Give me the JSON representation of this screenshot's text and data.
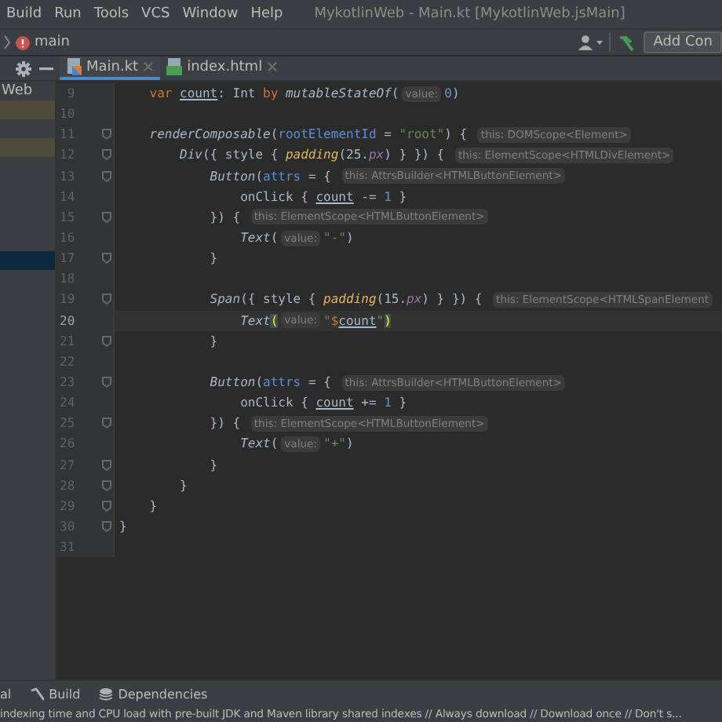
{
  "menu_bar": {
    "items": [
      "Build",
      "Run",
      "Tools",
      "VCS",
      "Window",
      "Help"
    ],
    "title": "MykotlinWeb - Main.kt [MykotlinWeb.jsMain]"
  },
  "nav_bar": {
    "branch": "main",
    "run_config_button": "Add Con"
  },
  "editor_tabs": [
    {
      "label": "Main.kt",
      "kind": "kotlin",
      "selected": true
    },
    {
      "label": "index.html",
      "kind": "html",
      "selected": false
    }
  ],
  "project_panel": {
    "title": "Web",
    "rows": [
      {
        "kind": "marked"
      },
      {
        "kind": "plain"
      },
      {
        "kind": "marked"
      },
      {
        "kind": "plain"
      },
      {
        "kind": "plain"
      },
      {
        "kind": "plain"
      },
      {
        "kind": "plain"
      },
      {
        "kind": "plain"
      },
      {
        "kind": "selected"
      }
    ]
  },
  "editor": {
    "lines": [
      {
        "number": "9",
        "fold": false,
        "current": false,
        "tokens": [
          {
            "kind": "kw",
            "text": "    var "
          },
          {
            "kind": "prop",
            "text": "count"
          },
          {
            "kind": "plain",
            "text": ": Int "
          },
          {
            "kind": "kw",
            "text": "by "
          },
          {
            "kind": "fn",
            "text": "mutableStateOf"
          },
          {
            "kind": "plain",
            "text": "("
          },
          {
            "kind": "hint",
            "text": "value:"
          },
          {
            "kind": "num",
            "text": "0"
          },
          {
            "kind": "plain",
            "text": ")"
          }
        ]
      },
      {
        "number": "10",
        "fold": false,
        "current": false
      },
      {
        "number": "11",
        "fold": true,
        "current": false,
        "tokens": [
          {
            "kind": "fn",
            "text": "    renderComposable"
          },
          {
            "kind": "plain",
            "text": "("
          },
          {
            "kind": "param",
            "text": "rootElementId"
          },
          {
            "kind": "plain",
            "text": " = "
          },
          {
            "kind": "str",
            "text": "\"root\""
          },
          {
            "kind": "plain",
            "text": ") { "
          },
          {
            "kind": "hint",
            "text": "this: DOMScope<Element>"
          }
        ]
      },
      {
        "number": "12",
        "fold": true,
        "current": false,
        "tokens": [
          {
            "kind": "fn",
            "text": "        Div"
          },
          {
            "kind": "plain",
            "text": "({ style { "
          },
          {
            "kind": "ext",
            "text": "padding"
          },
          {
            "kind": "plain",
            "text": "(25."
          },
          {
            "kind": "unit",
            "text": "px"
          },
          {
            "kind": "plain",
            "text": ") } }) { "
          },
          {
            "kind": "hint",
            "text": "this: ElementScope<HTMLDivElement>"
          }
        ]
      },
      {
        "number": "13",
        "fold": true,
        "current": false,
        "tokens": [
          {
            "kind": "fn",
            "text": "            Button"
          },
          {
            "kind": "plain",
            "text": "("
          },
          {
            "kind": "param",
            "text": "attrs"
          },
          {
            "kind": "plain",
            "text": " = { "
          },
          {
            "kind": "hint",
            "text": "this: AttrsBuilder<HTMLButtonElement>"
          }
        ]
      },
      {
        "number": "14",
        "fold": false,
        "current": false,
        "tokens": [
          {
            "kind": "plain",
            "text": "                onClick { "
          },
          {
            "kind": "prop",
            "text": "count"
          },
          {
            "kind": "plain",
            "text": " -= "
          },
          {
            "kind": "num",
            "text": "1"
          },
          {
            "kind": "plain",
            "text": " }"
          }
        ]
      },
      {
        "number": "15",
        "fold": true,
        "current": false,
        "tokens": [
          {
            "kind": "plain",
            "text": "            }) { "
          },
          {
            "kind": "hint",
            "text": "this: ElementScope<HTMLButtonElement>"
          }
        ]
      },
      {
        "number": "16",
        "fold": false,
        "current": false,
        "tokens": [
          {
            "kind": "fn",
            "text": "                Text"
          },
          {
            "kind": "plain",
            "text": "("
          },
          {
            "kind": "hint",
            "text": "value:"
          },
          {
            "kind": "str",
            "text": "\"-\""
          },
          {
            "kind": "plain",
            "text": ")"
          }
        ]
      },
      {
        "number": "17",
        "fold": true,
        "current": false,
        "tokens": [
          {
            "kind": "plain",
            "text": "            }"
          }
        ]
      },
      {
        "number": "18",
        "fold": false,
        "current": false
      },
      {
        "number": "19",
        "fold": true,
        "current": false,
        "tokens": [
          {
            "kind": "fn",
            "text": "            Span"
          },
          {
            "kind": "plain",
            "text": "({ style { "
          },
          {
            "kind": "ext",
            "text": "padding"
          },
          {
            "kind": "plain",
            "text": "(15."
          },
          {
            "kind": "unit",
            "text": "px"
          },
          {
            "kind": "plain",
            "text": ") } }) { "
          },
          {
            "kind": "hint",
            "text": "this: ElementScope<HTMLSpanElement"
          }
        ]
      },
      {
        "number": "20",
        "fold": false,
        "current": true,
        "tokens": [
          {
            "kind": "fn",
            "text": "                Text"
          },
          {
            "kind": "brace",
            "text": "("
          },
          {
            "kind": "hint",
            "text": "value:"
          },
          {
            "kind": "str",
            "text": "\""
          },
          {
            "kind": "tmpl",
            "text": "$"
          },
          {
            "kind": "strvar",
            "text": "count"
          },
          {
            "kind": "str",
            "text": "\""
          },
          {
            "kind": "brace",
            "text": ")"
          }
        ]
      },
      {
        "number": "21",
        "fold": true,
        "current": false,
        "tokens": [
          {
            "kind": "plain",
            "text": "            }"
          }
        ]
      },
      {
        "number": "22",
        "fold": false,
        "current": false
      },
      {
        "number": "23",
        "fold": true,
        "current": false,
        "tokens": [
          {
            "kind": "fn",
            "text": "            Button"
          },
          {
            "kind": "plain",
            "text": "("
          },
          {
            "kind": "param",
            "text": "attrs"
          },
          {
            "kind": "plain",
            "text": " = { "
          },
          {
            "kind": "hint",
            "text": "this: AttrsBuilder<HTMLButtonElement>"
          }
        ]
      },
      {
        "number": "24",
        "fold": false,
        "current": false,
        "tokens": [
          {
            "kind": "plain",
            "text": "                onClick { "
          },
          {
            "kind": "prop",
            "text": "count"
          },
          {
            "kind": "plain",
            "text": " += "
          },
          {
            "kind": "num",
            "text": "1"
          },
          {
            "kind": "plain",
            "text": " }"
          }
        ]
      },
      {
        "number": "25",
        "fold": true,
        "current": false,
        "tokens": [
          {
            "kind": "plain",
            "text": "            }) { "
          },
          {
            "kind": "hint",
            "text": "this: ElementScope<HTMLButtonElement>"
          }
        ]
      },
      {
        "number": "26",
        "fold": false,
        "current": false,
        "tokens": [
          {
            "kind": "fn",
            "text": "                Text"
          },
          {
            "kind": "plain",
            "text": "("
          },
          {
            "kind": "hint",
            "text": "value:"
          },
          {
            "kind": "str",
            "text": "\"+\""
          },
          {
            "kind": "plain",
            "text": ")"
          }
        ]
      },
      {
        "number": "27",
        "fold": true,
        "current": false,
        "tokens": [
          {
            "kind": "plain",
            "text": "            }"
          }
        ]
      },
      {
        "number": "28",
        "fold": true,
        "current": false,
        "tokens": [
          {
            "kind": "plain",
            "text": "        }"
          }
        ]
      },
      {
        "number": "29",
        "fold": true,
        "current": false,
        "tokens": [
          {
            "kind": "plain",
            "text": "    }"
          }
        ]
      },
      {
        "number": "30",
        "fold": true,
        "current": false,
        "tokens": [
          {
            "kind": "plain",
            "text": "}"
          }
        ]
      },
      {
        "number": "31",
        "fold": false,
        "current": false
      }
    ]
  },
  "tool_windows": [
    {
      "label": "al",
      "kind": "terminal"
    },
    {
      "label": "Build",
      "kind": "build"
    },
    {
      "label": "Dependencies",
      "kind": "dependencies"
    }
  ],
  "status_bar": {
    "text": "indexing time and CPU load with pre-built JDK and Maven library shared indexes // Always download // Download once // Don't s..."
  }
}
